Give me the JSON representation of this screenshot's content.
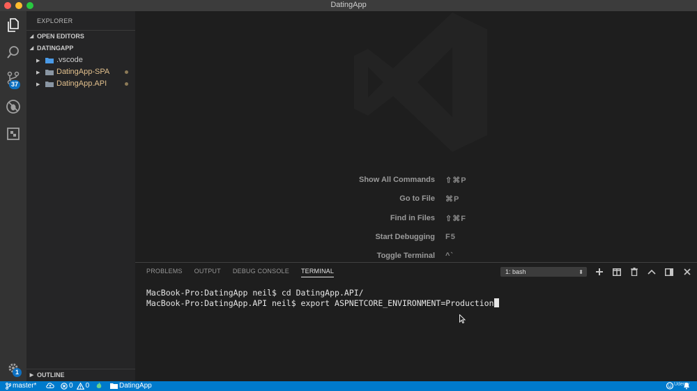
{
  "window": {
    "title": "DatingApp"
  },
  "activity_bar": {
    "icons": [
      "files-icon",
      "search-icon",
      "source-control-icon",
      "debug-icon",
      "extensions-icon",
      "settings-gear-icon"
    ],
    "source_control_badge": "37",
    "settings_badge": "1"
  },
  "sidebar": {
    "title": "EXPLORER",
    "open_editors": "OPEN EDITORS",
    "root": "DATINGAPP",
    "items": [
      {
        "label": ".vscode",
        "color": "#cccccc"
      },
      {
        "label": "DatingApp-SPA",
        "color": "#e2c08d"
      },
      {
        "label": "DatingApp.API",
        "color": "#e2c08d"
      }
    ],
    "outline": "OUTLINE"
  },
  "editor": {
    "shortcuts": [
      {
        "label": "Show All Commands",
        "keys": "⇧⌘P"
      },
      {
        "label": "Go to File",
        "keys": "⌘P"
      },
      {
        "label": "Find in Files",
        "keys": "⇧⌘F"
      },
      {
        "label": "Start Debugging",
        "keys": "F5"
      },
      {
        "label": "Toggle Terminal",
        "keys": "^`"
      }
    ]
  },
  "panel": {
    "tabs": [
      {
        "label": "PROBLEMS",
        "active": false
      },
      {
        "label": "OUTPUT",
        "active": false
      },
      {
        "label": "DEBUG CONSOLE",
        "active": false
      },
      {
        "label": "TERMINAL",
        "active": true
      }
    ],
    "terminal_select": "1: bash",
    "buttons": [
      "add-icon",
      "split-icon",
      "trash-icon",
      "maximize-chevron-icon",
      "panel-layout-icon",
      "close-icon"
    ],
    "lines": [
      "MacBook-Pro:DatingApp neil$ cd DatingApp.API/",
      "MacBook-Pro:DatingApp.API neil$ export ASPNETCORE_ENVIRONMENT=Production"
    ]
  },
  "status_bar": {
    "branch": "master*",
    "errors": "0",
    "warnings": "0",
    "folder": "DatingApp",
    "watermark": "Udemy",
    "accent": "#007acc"
  }
}
